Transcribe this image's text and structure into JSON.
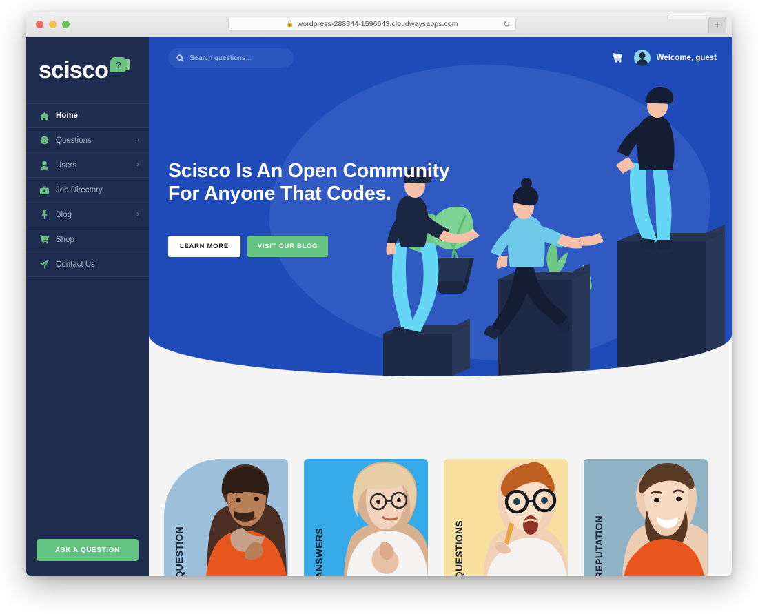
{
  "browser": {
    "url": "wordpress-288344-1596643.cloudwaysapps.com",
    "lock_icon": "lock-icon",
    "reload_icon": "reload-icon",
    "newtab_label": "+"
  },
  "sidebar": {
    "logo_text": "scisco",
    "logo_badge": "?",
    "items": [
      {
        "label": "Home",
        "icon": "home-icon",
        "active": true,
        "chevron": ""
      },
      {
        "label": "Questions",
        "icon": "question-circle-icon",
        "active": false,
        "chevron": "›"
      },
      {
        "label": "Users",
        "icon": "user-icon",
        "active": false,
        "chevron": "›"
      },
      {
        "label": "Job Directory",
        "icon": "briefcase-icon",
        "active": false,
        "chevron": ""
      },
      {
        "label": "Blog",
        "icon": "thumbtack-icon",
        "active": false,
        "chevron": "›"
      },
      {
        "label": "Shop",
        "icon": "shopping-cart-icon",
        "active": false,
        "chevron": ""
      },
      {
        "label": "Contact Us",
        "icon": "paper-plane-icon",
        "active": false,
        "chevron": ""
      }
    ],
    "ask_button": "ASK A QUESTION"
  },
  "topbar": {
    "search_placeholder": "Search questions...",
    "search_value": "",
    "cart_icon": "shopping-cart-icon",
    "avatar_icon": "user-avatar",
    "welcome": "Welcome, guest"
  },
  "hero": {
    "title_line1": "Scisco Is An Open Community",
    "title_line2": "For Anyone That Codes.",
    "btn_primary": "LEARN MORE",
    "btn_secondary": "VISIT OUR BLOG"
  },
  "cards": [
    {
      "label": "QUESTION",
      "bg": "#9dc0dc"
    },
    {
      "label": "ANSWERS",
      "bg": "#36a9e8"
    },
    {
      "label": "QUESTIONS",
      "bg": "#f7df9f"
    },
    {
      "label": "REPUTATION",
      "bg": "#8fb3c4"
    }
  ],
  "colors": {
    "sidebar_bg": "#1e2d4f",
    "hero_blue": "#1e4bb8",
    "accent_green": "#64c283",
    "page_bg": "#f4f4f4"
  }
}
